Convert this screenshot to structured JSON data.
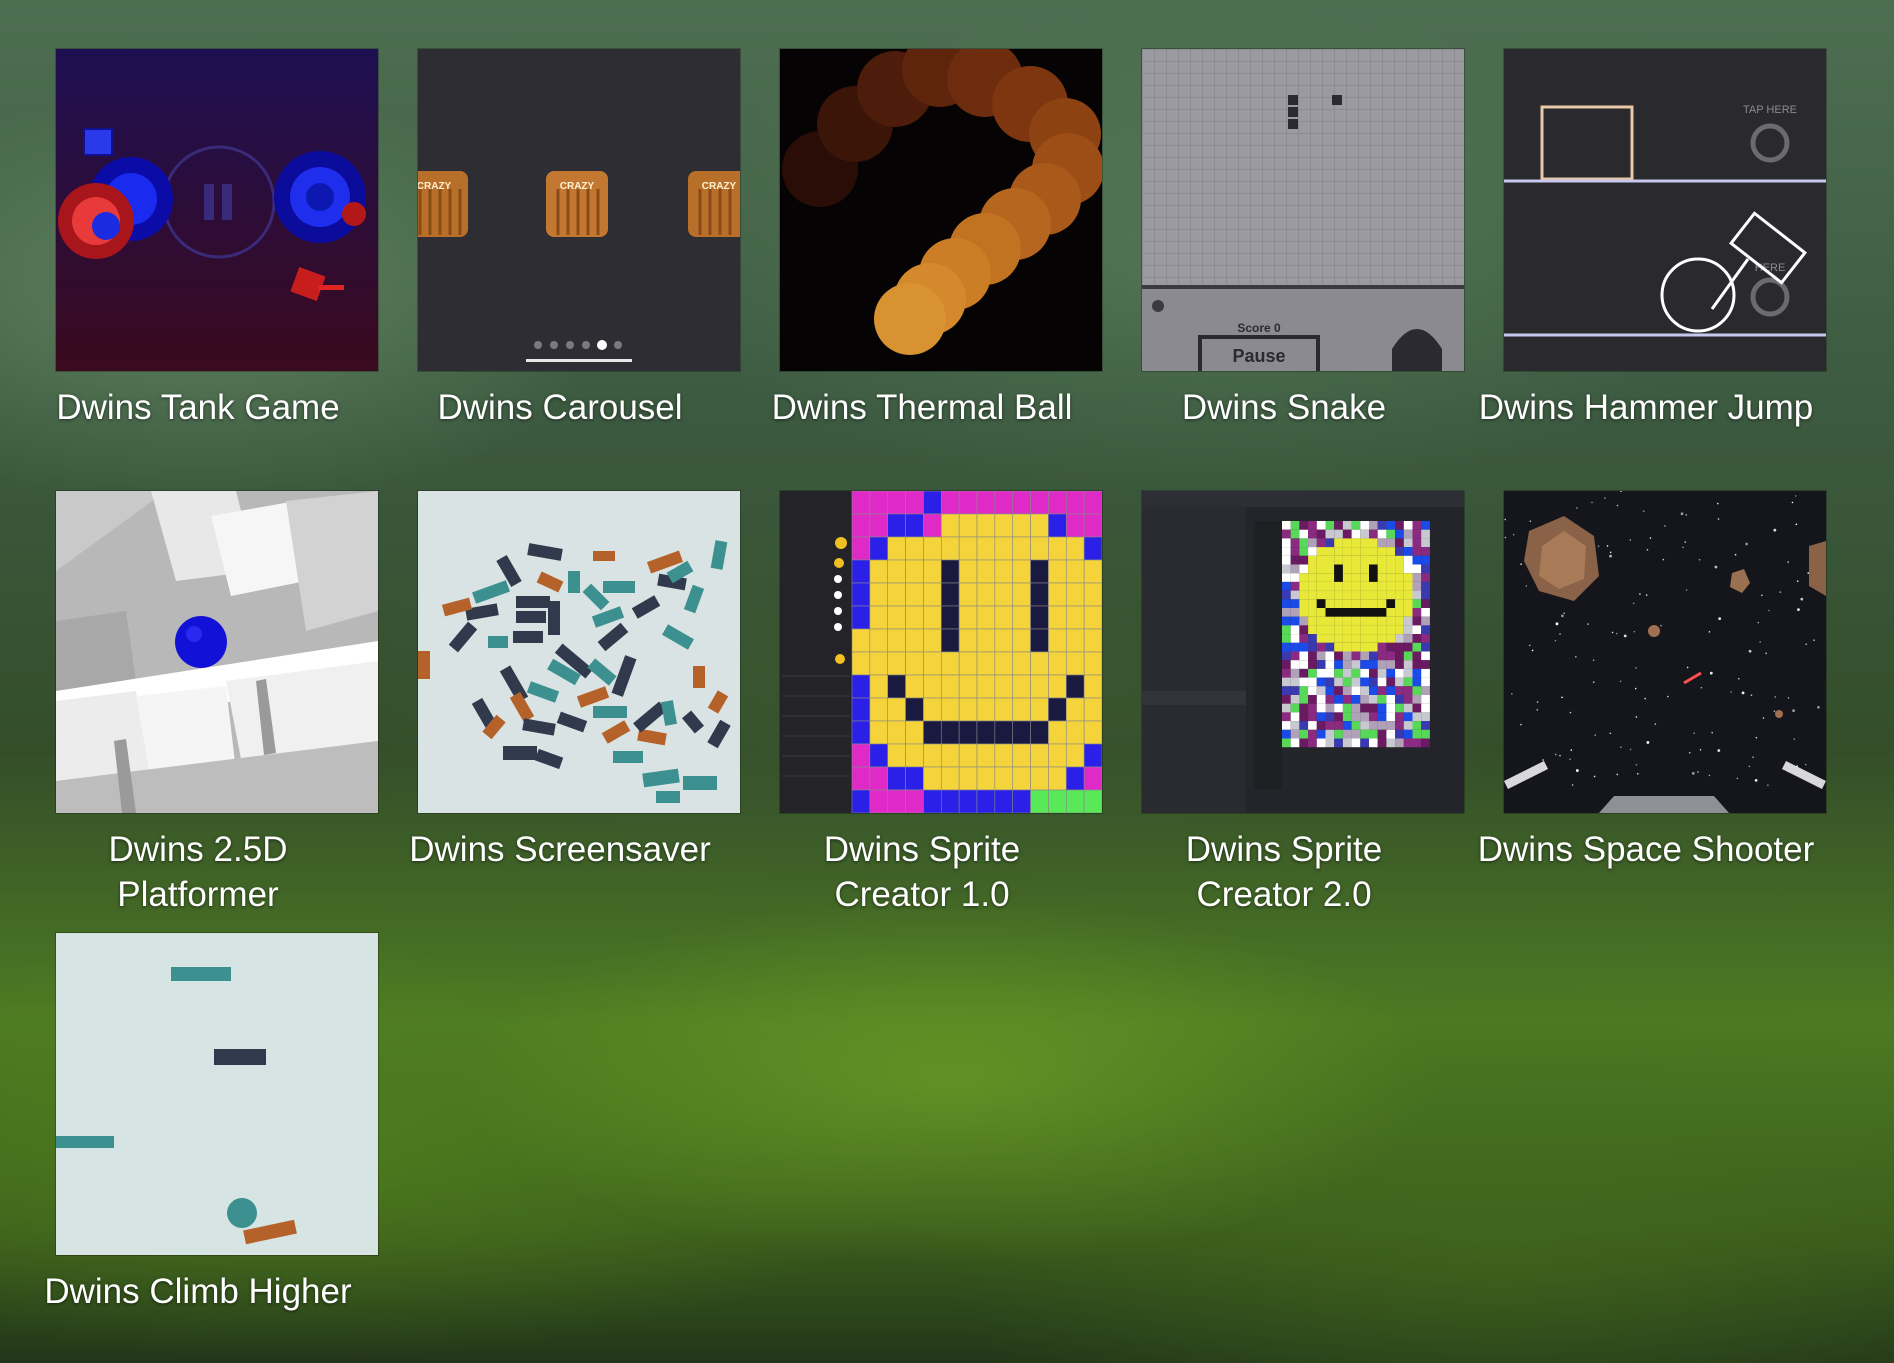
{
  "apps": [
    {
      "name": "Dwins Tank Game"
    },
    {
      "name": "Dwins Carousel",
      "thumbnail_text": {
        "card_label": "CRAZY"
      }
    },
    {
      "name": "Dwins Thermal Ball"
    },
    {
      "name": "Dwins Snake",
      "thumbnail_text": {
        "score": "Score 0",
        "pause": "Pause"
      }
    },
    {
      "name": "Dwins Hammer Jump",
      "thumbnail_text": {
        "tap_here": "TAP HERE",
        "here": "HERE"
      }
    },
    {
      "name_line1": "Dwins 2.5D",
      "name_line2": "Platformer"
    },
    {
      "name": "Dwins Screensaver"
    },
    {
      "name_line1": "Dwins Sprite",
      "name_line2": "Creator 1.0"
    },
    {
      "name_line1": "Dwins Sprite",
      "name_line2": "Creator 2.0"
    },
    {
      "name": "Dwins Space Shooter"
    },
    {
      "name": "Dwins Climb Higher"
    }
  ],
  "colors": {
    "label_text": "#ffffff",
    "tank_bg": "#2a0f4a",
    "carousel_bg": "#2d2d33",
    "snake_bg": "#8e8e94",
    "hammer_bg": "#2a2a2e",
    "screensaver_bg": "#d9e3e3",
    "space_bg": "#15151c",
    "climb_bg": "#d6e4e4"
  }
}
